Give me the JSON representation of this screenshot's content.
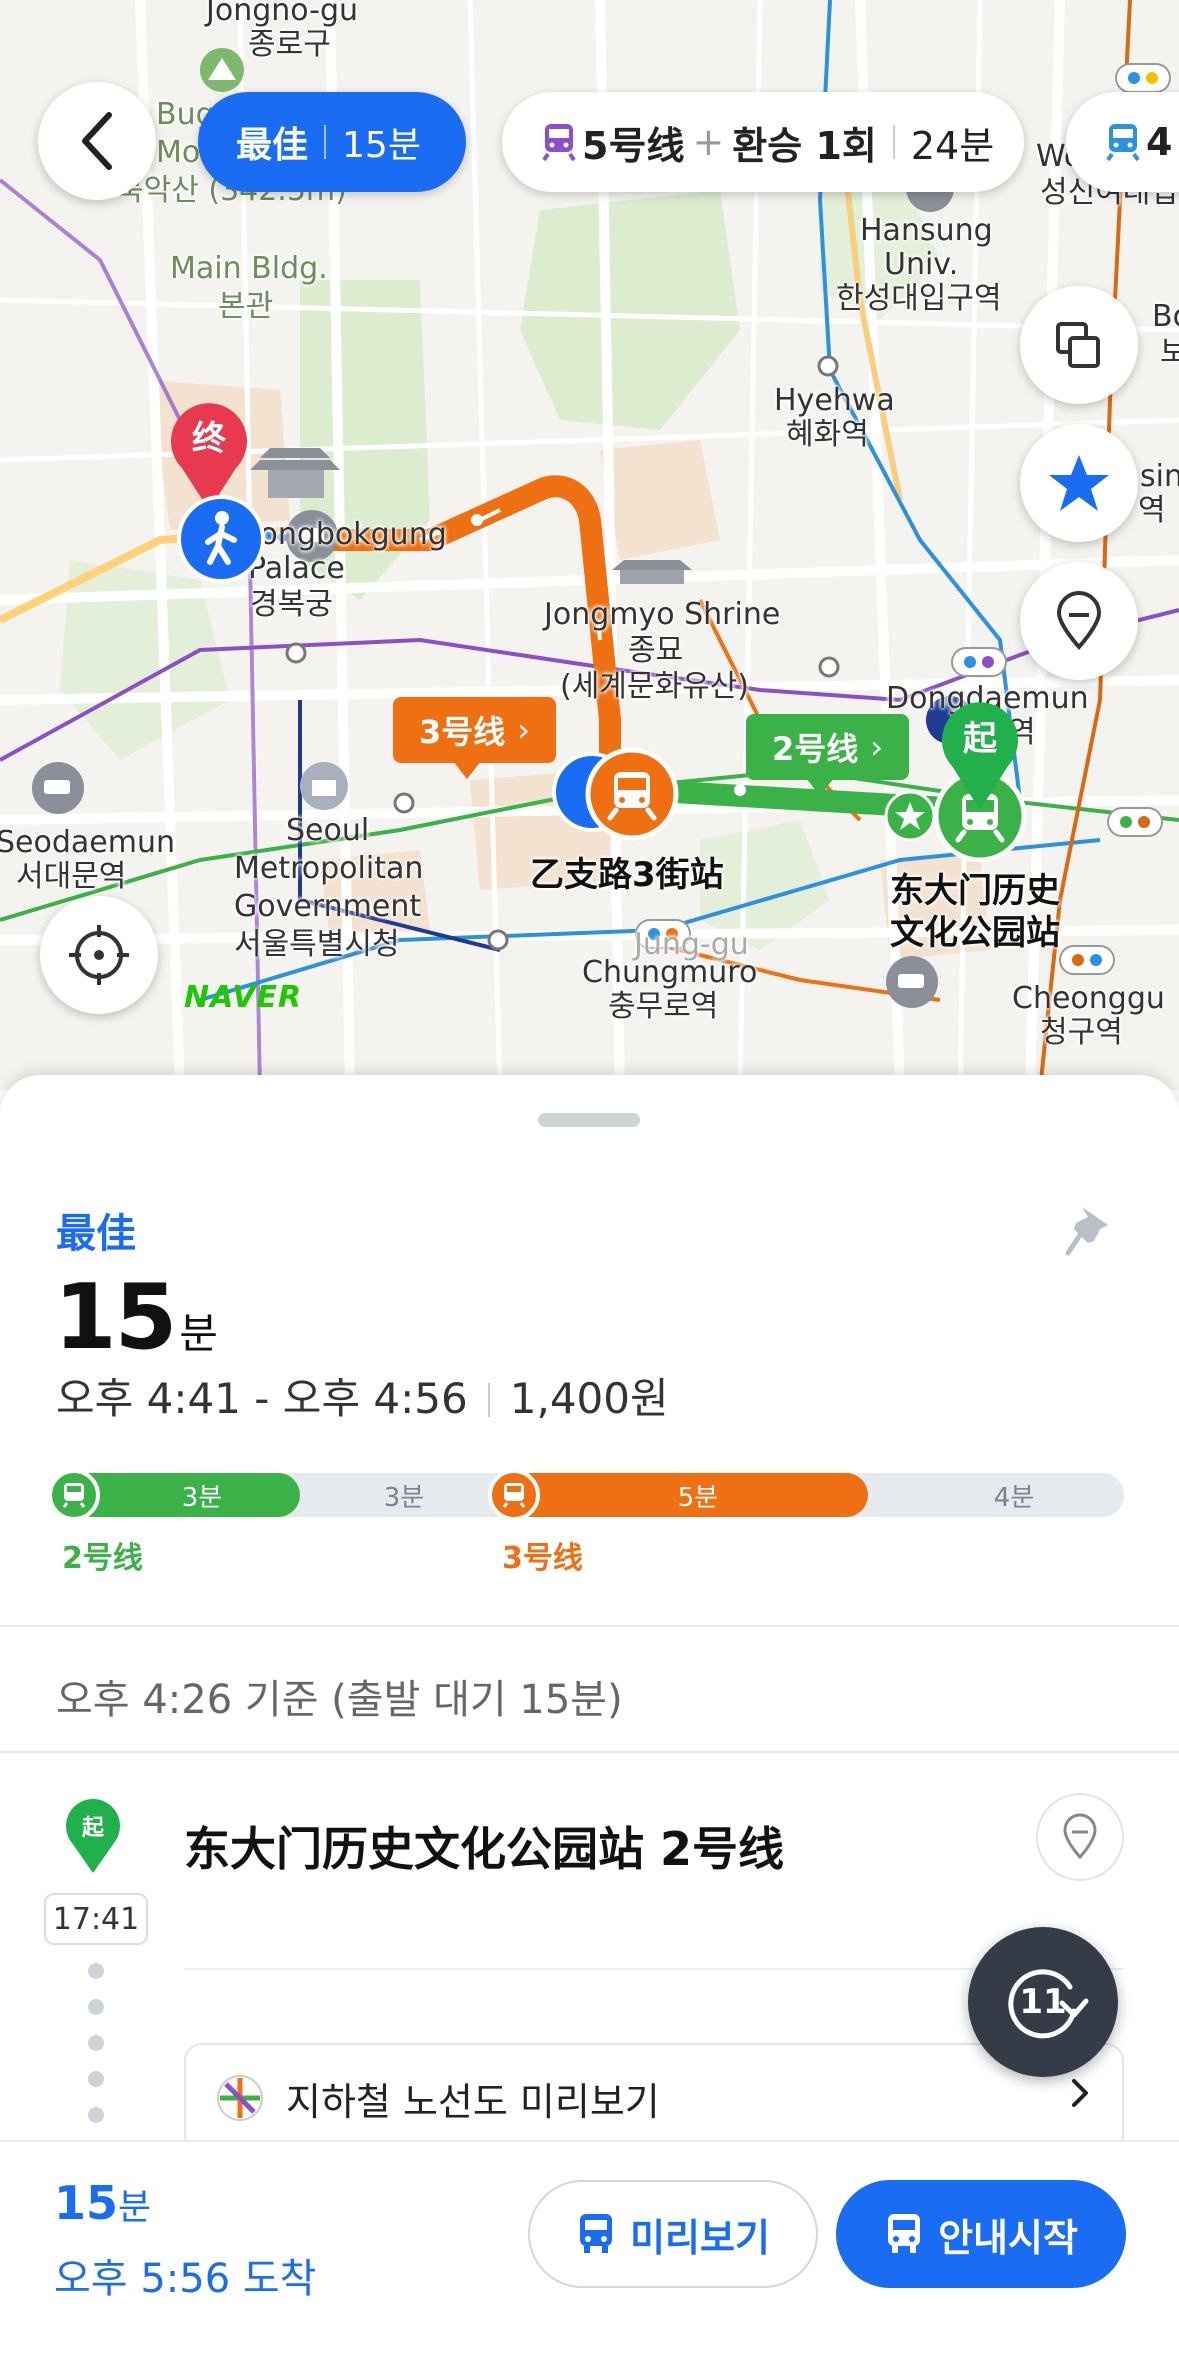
{
  "map": {
    "labels": {
      "jongno_gu_en": "Jongno-gu",
      "jongno_gu_ko": "종로구",
      "bugak_a": "Bug",
      "bugak_b": "Mo",
      "bugak_c": "북악산 (342.5m)",
      "main_bldg_en": "Main Bldg.",
      "main_bldg_ko": "본관",
      "hansung_en": "Hansung",
      "hansung_en2": "Univ.",
      "hansung_ko": "한성대입구역",
      "hyehwa_en": "Hyehwa",
      "hyehwa_ko": "혜화역",
      "gyeongbok_en": "Gyeongbokgung",
      "gyeongbok_en2": "Palace",
      "gyeongbok_ko": "경복궁",
      "jongmyo_en": "Jongmyo Shrine",
      "jongmyo_ko": "종묘",
      "jongmyo_ko2": "(세계문화유산)",
      "dongdaemun_en": "Dongdaemun",
      "dongdaemun_ko": "역",
      "seodaemun_en": "Seodaemun",
      "seodaemun_ko": "서대문역",
      "seoul_city_en1": "Seoul",
      "seoul_city_en2": "Metropolitan",
      "seoul_city_en3": "Government",
      "seoul_city_ko": "서울특별시청",
      "euljiro": "乙支路3街站",
      "ddp_1": "东大门历史",
      "ddp_2": "文化公园站",
      "junggu": "Jung-gu",
      "chungmuro_en": "Chungmuro",
      "chungmuro_ko": "충무로역",
      "cheonggu_en": "Cheonggu",
      "cheonggu_ko": "청구역",
      "wo": "Wo",
      "seongsin": "성신여대입",
      "bo": "Bo",
      "bo2": "보",
      "sin": "sin",
      "sin2": "역"
    },
    "end_marker": "终",
    "start_marker": "起",
    "line3_tag": "3号线",
    "line2_tag": "2号线",
    "naver_logo": "NAVER"
  },
  "top_chips": {
    "best_label": "最佳",
    "best_time": "15분",
    "route_line": "5号线",
    "route_plus": "+",
    "route_transfer": "환승 1회",
    "route_time": "24분",
    "more_label": "4"
  },
  "summary": {
    "best_label": "最佳",
    "duration_num": "15",
    "duration_unit": "분",
    "time_range": "오후 4:41 - 오후 4:56",
    "fare": "1,400원",
    "segments": {
      "seg1": "3분",
      "seg2": "3분",
      "seg3": "5분",
      "seg4": "4분"
    },
    "line_a": "2号线",
    "line_b": "3号线"
  },
  "standby": "오후 4:26 기준 (출발 대기 15분)",
  "step": {
    "start_badge": "起",
    "time": "17:41",
    "station": "东大门历史文化公园站 2号线",
    "subway_map_label": "지하철 노선도 미리보기",
    "refresh_count": "11"
  },
  "bottom": {
    "duration_num": "15",
    "duration_unit": "분",
    "arrive": "오후 5:56 도착",
    "preview_label": "미리보기",
    "start_label": "안내시작"
  },
  "colors": {
    "accent": "#1a6cf2",
    "line2": "#3bb248",
    "line3": "#ef7012",
    "line5": "#8b50c8"
  }
}
